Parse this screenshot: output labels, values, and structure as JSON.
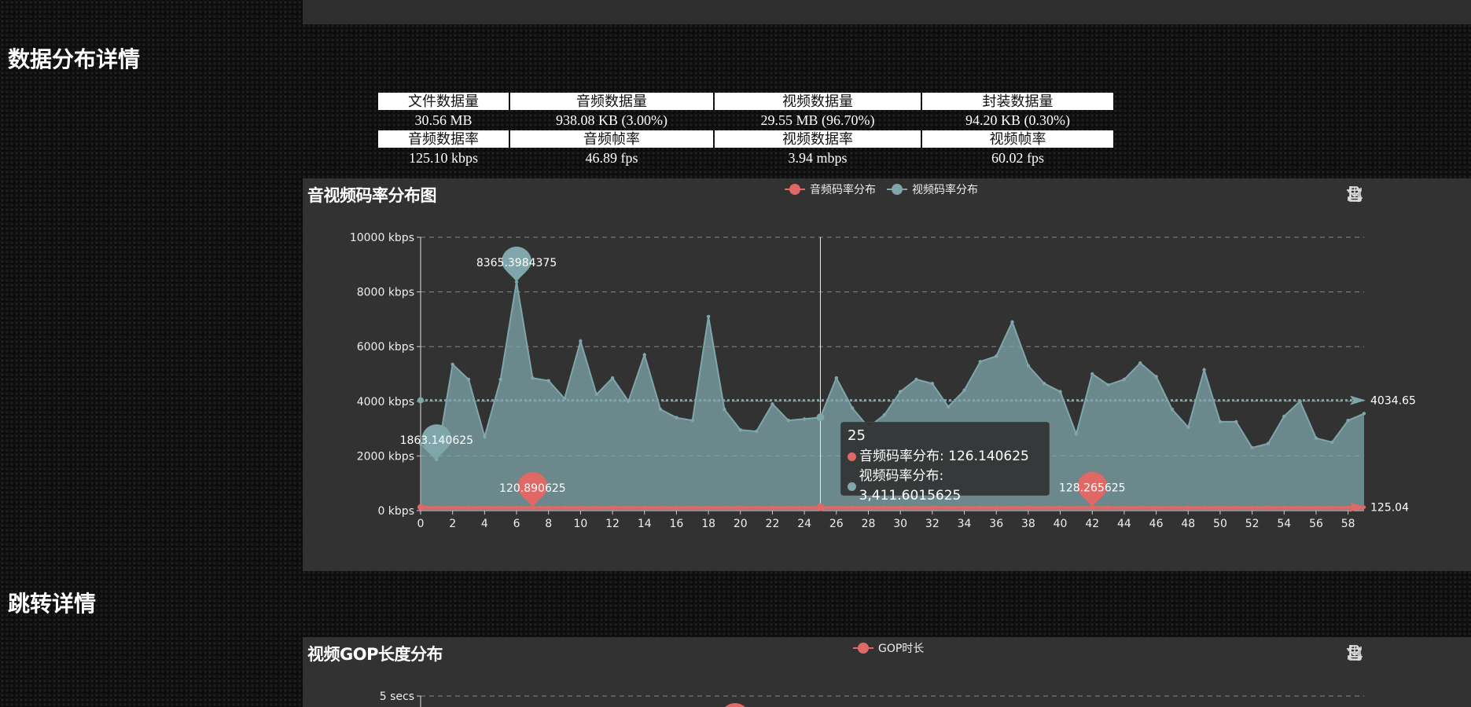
{
  "sections": {
    "data_distribution": "数据分布详情",
    "seek_details": "跳转详情"
  },
  "stats": {
    "header1": [
      "文件数据量",
      "音频数据量",
      "视频数据量",
      "封装数据量"
    ],
    "values1": [
      "30.56 MB",
      "938.08 KB (3.00%)",
      "29.55 MB (96.70%)",
      "94.20 KB (0.30%)"
    ],
    "header2": [
      "音频数据率",
      "音频帧率",
      "视频数据率",
      "视频帧率"
    ],
    "values2": [
      "125.10 kbps",
      "46.89 fps",
      "3.94 mbps",
      "60.02 fps"
    ]
  },
  "colors": {
    "audio": "#e06965",
    "video": "#7fa6ab",
    "panel_bg": "#323232"
  },
  "toolbox_icons": [
    "data-view-icon",
    "restore-icon",
    "save-image-icon",
    "zoom-icon",
    "zoom-reset-icon"
  ],
  "chart_data": [
    {
      "type": "area",
      "title": "音视频码率分布图",
      "y_unit": "kbps",
      "xlabel": "",
      "ylabel": "",
      "ylim": [
        0,
        10000
      ],
      "y_ticks": [
        "0 kbps",
        "2000 kbps",
        "4000 kbps",
        "6000 kbps",
        "8000 kbps",
        "10000 kbps"
      ],
      "x_ticks": [
        "0",
        "2",
        "4",
        "6",
        "8",
        "10",
        "12",
        "14",
        "16",
        "18",
        "20",
        "22",
        "24",
        "26",
        "28",
        "30",
        "32",
        "34",
        "36",
        "38",
        "40",
        "42",
        "44",
        "46",
        "48",
        "50",
        "52",
        "54",
        "56",
        "58"
      ],
      "grid": true,
      "legend_position": "top-center",
      "x": [
        0,
        1,
        2,
        3,
        4,
        5,
        6,
        7,
        8,
        9,
        10,
        11,
        12,
        13,
        14,
        15,
        16,
        17,
        18,
        19,
        20,
        21,
        22,
        23,
        24,
        25,
        26,
        27,
        28,
        29,
        30,
        31,
        32,
        33,
        34,
        35,
        36,
        37,
        38,
        39,
        40,
        41,
        42,
        43,
        44,
        45,
        46,
        47,
        48,
        49,
        50,
        51,
        52,
        53,
        54,
        55,
        56,
        57,
        58,
        59
      ],
      "series": [
        {
          "name": "音频码率分布",
          "values": [
            125,
            121,
            125,
            125,
            126,
            124,
            125,
            120.890625,
            126,
            125,
            125,
            124,
            126,
            125,
            125,
            124,
            126,
            125,
            125,
            124,
            126,
            125,
            125,
            124,
            126,
            126.140625,
            125,
            124,
            126,
            125,
            125,
            124,
            126,
            125,
            125,
            124,
            126,
            125,
            125,
            124,
            126,
            125,
            128.265625,
            125,
            124,
            126,
            125,
            125,
            124,
            126,
            125,
            125,
            124,
            126,
            125,
            125,
            124,
            126,
            125,
            125
          ],
          "max_label": "128.265625",
          "max_x": 42,
          "min_label": "120.890625",
          "min_x": 7,
          "average": "125.04",
          "average_value": 125.04
        },
        {
          "name": "视频码率分布",
          "values": [
            2450,
            1863.140625,
            5350,
            4800,
            2700,
            4800,
            8365.3984375,
            4850,
            4750,
            4100,
            6200,
            4250,
            4850,
            4000,
            5700,
            3700,
            3400,
            3300,
            7100,
            3700,
            2950,
            2900,
            3900,
            3300,
            3350,
            3411.6015625,
            4850,
            3750,
            3050,
            3500,
            4350,
            4800,
            4650,
            3800,
            4400,
            5450,
            5650,
            6900,
            5300,
            4650,
            4350,
            2800,
            5000,
            4600,
            4800,
            5400,
            4900,
            3700,
            3050,
            5150,
            3250,
            3250,
            2300,
            2450,
            3450,
            4000,
            2650,
            2500,
            3300,
            3550
          ],
          "max_label": "8365.3984375",
          "max_x": 6,
          "min_label": "1863.140625",
          "min_x": 1,
          "average": "4034.65",
          "average_value": 4034.65
        }
      ],
      "tooltip": {
        "title": "25",
        "rows": [
          "音频码率分布: 126.140625",
          "视频码率分布: 3,411.6015625"
        ]
      },
      "pointer_x": 25
    },
    {
      "type": "line",
      "title": "视频GOP长度分布",
      "legend": [
        "GOP时长"
      ],
      "y_ticks": [
        "5 secs"
      ],
      "legend_position": "top-center"
    }
  ]
}
